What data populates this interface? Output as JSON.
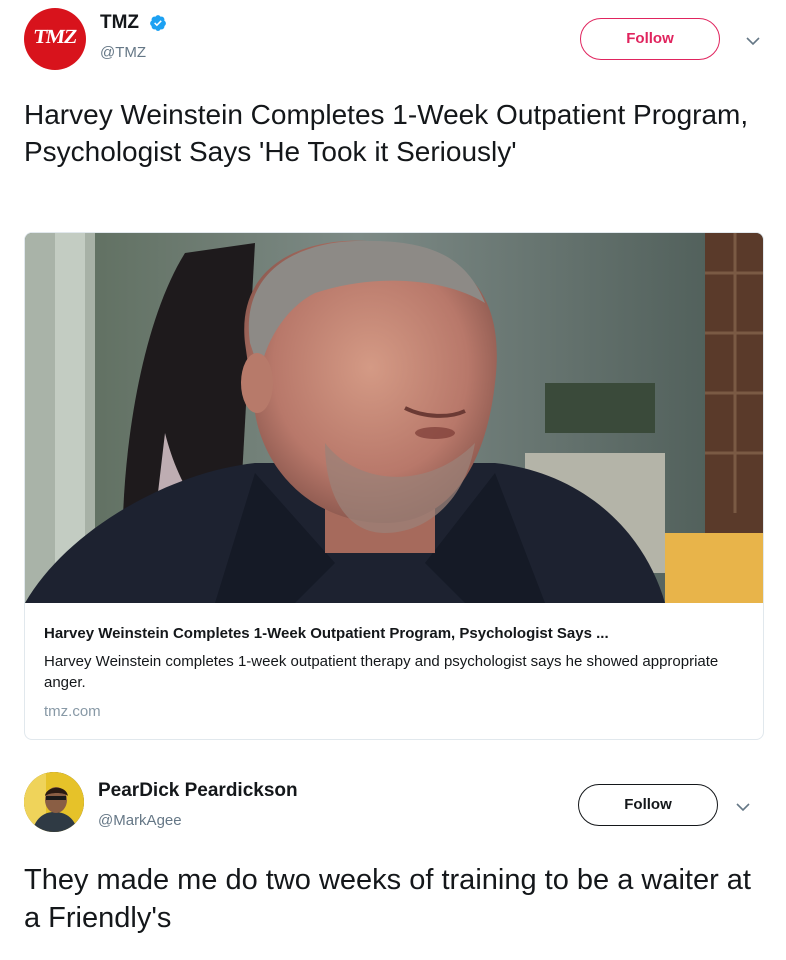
{
  "tweets": [
    {
      "author": {
        "display_name": "TMZ",
        "handle": "@TMZ",
        "verified": true,
        "avatar_text": "TMZ"
      },
      "follow_label": "Follow",
      "text": "Harvey Weinstein Completes 1-Week Outpatient Program, Psychologist Says 'He Took it Seriously'",
      "card": {
        "title": "Harvey Weinstein Completes 1-Week Outpatient Program, Psychologist Says ...",
        "description": "Harvey Weinstein completes 1-week outpatient therapy and psychologist says he showed appropriate anger.",
        "domain": "tmz.com",
        "image_icon": "person-photo"
      }
    },
    {
      "author": {
        "display_name": "PearDick Peardickson",
        "handle": "@MarkAgee",
        "verified": false
      },
      "follow_label": "Follow",
      "text": "They made me do two weeks of training to be a waiter at a Friendly's"
    }
  ],
  "colors": {
    "tmz_red": "#d8131c",
    "follow_pink": "#e0245e",
    "verified_blue": "#1da1f2",
    "muted_text": "#657786"
  }
}
